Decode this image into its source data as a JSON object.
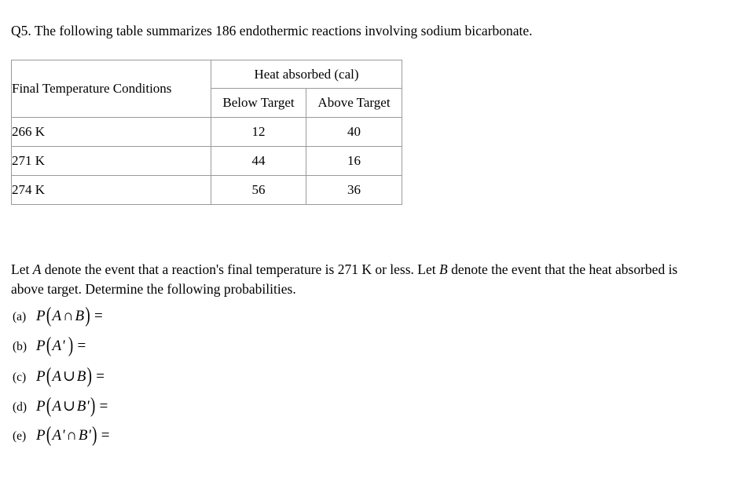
{
  "question": {
    "label": "Q5.",
    "stem": "Q5. The following table summarizes 186 endothermic reactions involving sodium bicarbonate."
  },
  "table": {
    "row_header_label": "Final Temperature Conditions",
    "group_header": "Heat absorbed (cal)",
    "column_headers": [
      "Below Target",
      "Above Target"
    ],
    "rows": [
      {
        "label": "266 K",
        "below_target": "12",
        "above_target": "40"
      },
      {
        "label": "271 K",
        "below_target": "44",
        "above_target": "16"
      },
      {
        "label": "274 K",
        "below_target": "56",
        "above_target": "36"
      }
    ]
  },
  "statement": {
    "part1": "Let ",
    "var_a": "A",
    "part2": " denote the event that a reaction's final temperature is 271 K or less. Let ",
    "var_b": "B",
    "part3": " denote the event that the heat absorbed is above target. Determine the following probabilities."
  },
  "answers": [
    {
      "marker": "(a)",
      "expression": "P(A∩B) =",
      "prob": "P",
      "open": "(",
      "lhs": "A",
      "operator": "∩",
      "rhs": "B",
      "close": ")",
      "equals": "="
    },
    {
      "marker": "(b)",
      "expression": "P(A') =",
      "prob": "P",
      "open": "(",
      "lhs": "A'",
      "operator": "",
      "rhs": "",
      "close": ")",
      "equals": "="
    },
    {
      "marker": "(c)",
      "expression": "P(A∪B) =",
      "prob": "P",
      "open": "(",
      "lhs": "A",
      "operator": "∪",
      "rhs": "B",
      "close": ")",
      "equals": "="
    },
    {
      "marker": "(d)",
      "expression": "P(A∪B') =",
      "prob": "P",
      "open": "(",
      "lhs": "A",
      "operator": "∪",
      "rhs": "B'",
      "close": ")",
      "equals": "="
    },
    {
      "marker": "(e)",
      "expression": "P(A'∩B') =",
      "prob": "P",
      "open": "(",
      "lhs": "A'",
      "operator": "∩",
      "rhs": "B'",
      "close": ")",
      "equals": "="
    }
  ],
  "colors": {
    "background": "#ffffff",
    "text": "#000000",
    "table_border": "#9a9a9a"
  }
}
